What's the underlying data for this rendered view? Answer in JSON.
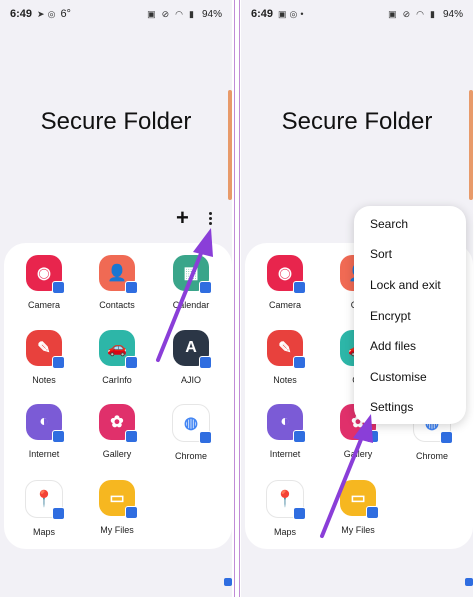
{
  "left_screen": {
    "status": {
      "time": "6:49",
      "left_icons": [
        "➤",
        "◎",
        "6°"
      ],
      "battery": "94%"
    },
    "title": "Secure Folder",
    "toolbar": {
      "add_label": "+"
    },
    "apps": [
      {
        "label": "Camera",
        "color": "#e8254d",
        "glyph": "◉"
      },
      {
        "label": "Contacts",
        "color": "#f06a54",
        "glyph": "👤"
      },
      {
        "label": "Calendar",
        "color": "#3aa58a",
        "glyph": "▦"
      },
      {
        "label": "Notes",
        "color": "#e8413d",
        "glyph": "✎"
      },
      {
        "label": "CarInfo",
        "color": "#2db6a8",
        "glyph": "🚗"
      },
      {
        "label": "AJIO",
        "color": "#2b3646",
        "glyph": "A"
      },
      {
        "label": "Internet",
        "color": "#7b5bd6",
        "glyph": "◐"
      },
      {
        "label": "Gallery",
        "color": "#e0306b",
        "glyph": "✿"
      },
      {
        "label": "Chrome",
        "color": "#ffffff",
        "glyph": "◍"
      },
      {
        "label": "Maps",
        "color": "#ffffff",
        "glyph": "📍"
      },
      {
        "label": "My Files",
        "color": "#f6b720",
        "glyph": "▭"
      }
    ]
  },
  "right_screen": {
    "status": {
      "time": "6:49",
      "left_icons": [
        "▣",
        "◎"
      ],
      "battery": "94%"
    },
    "title": "Secure Folder",
    "menu": [
      "Search",
      "Sort",
      "Lock and exit",
      "Encrypt",
      "Add files",
      "Customise",
      "Settings"
    ],
    "apps": [
      {
        "label": "Camera",
        "color": "#e8254d",
        "glyph": "◉"
      },
      {
        "label": "Cor",
        "color": "#f06a54",
        "glyph": "👤"
      },
      {
        "label": "",
        "color": "#ffffff",
        "glyph": ""
      },
      {
        "label": "Notes",
        "color": "#e8413d",
        "glyph": "✎"
      },
      {
        "label": "Ca",
        "color": "#2db6a8",
        "glyph": "🚗"
      },
      {
        "label": "",
        "color": "#ffffff",
        "glyph": ""
      },
      {
        "label": "Internet",
        "color": "#7b5bd6",
        "glyph": "◐"
      },
      {
        "label": "Gallery",
        "color": "#e0306b",
        "glyph": "✿"
      },
      {
        "label": "Chrome",
        "color": "#ffffff",
        "glyph": "◍"
      },
      {
        "label": "Maps",
        "color": "#ffffff",
        "glyph": "📍"
      },
      {
        "label": "My Files",
        "color": "#f6b720",
        "glyph": "▭"
      }
    ]
  },
  "colors": {
    "arrow": "#8a3ed8",
    "accent": "#2f6de0",
    "scroll_handle": "#e89a6a"
  }
}
